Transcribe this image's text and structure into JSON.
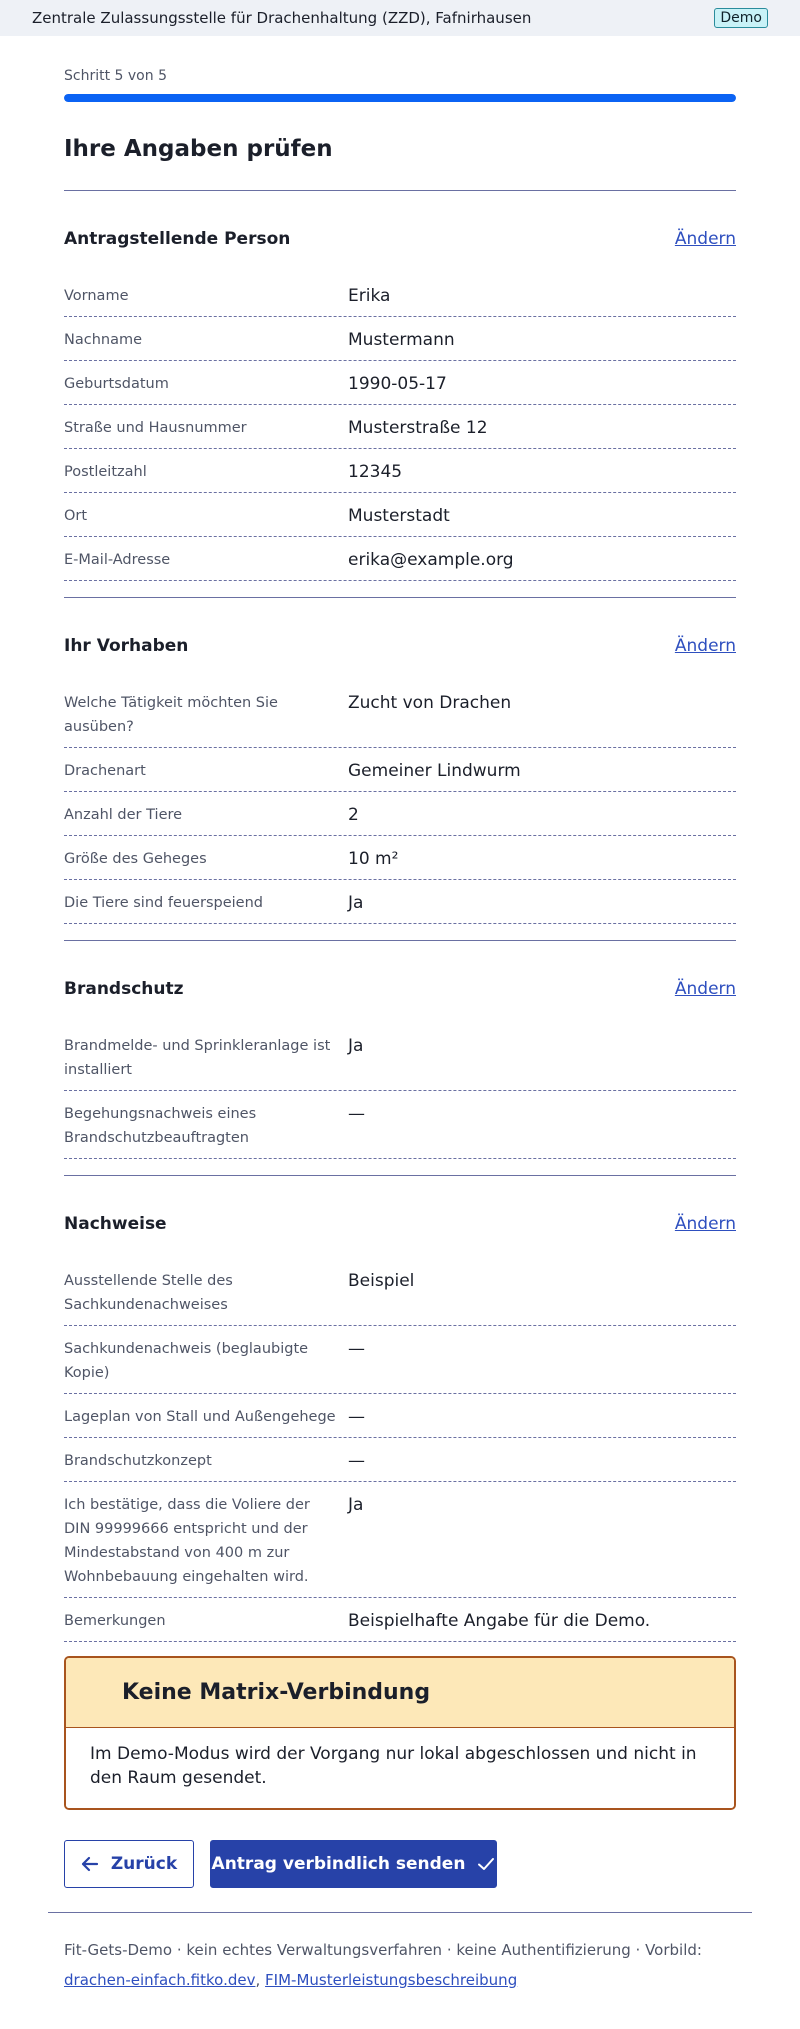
{
  "header": {
    "org": "Zentrale Zulassungsstelle für Drachenhaltung (ZZD), Fafnirhausen",
    "badge": "Demo"
  },
  "progress": {
    "step_label": "Schritt 5 von 5",
    "fraction": 1.0
  },
  "page_title": "Ihre Angaben prüfen",
  "sections": [
    {
      "title": "Antragstellende Person",
      "edit_label": "Ändern",
      "rows": [
        {
          "label": "Vorname",
          "value": "Erika"
        },
        {
          "label": "Nachname",
          "value": "Mustermann"
        },
        {
          "label": "Geburtsdatum",
          "value": "1990-05-17"
        },
        {
          "label": "Straße und Hausnummer",
          "value": "Musterstraße 12"
        },
        {
          "label": "Postleitzahl",
          "value": "12345"
        },
        {
          "label": "Ort",
          "value": "Musterstadt"
        },
        {
          "label": "E-Mail-Adresse",
          "value": "erika@example.org"
        }
      ]
    },
    {
      "title": "Ihr Vorhaben",
      "edit_label": "Ändern",
      "rows": [
        {
          "label": "Welche Tätigkeit möchten Sie ausüben?",
          "value": "Zucht von Drachen"
        },
        {
          "label": "Drachenart",
          "value": "Gemeiner Lindwurm"
        },
        {
          "label": "Anzahl der Tiere",
          "value": "2"
        },
        {
          "label": "Größe des Geheges",
          "value": "10 m²"
        },
        {
          "label": "Die Tiere sind feuerspeiend",
          "value": "Ja"
        }
      ]
    },
    {
      "title": "Brandschutz",
      "edit_label": "Ändern",
      "rows": [
        {
          "label": "Brandmelde- und Sprinkleranlage ist installiert",
          "value": "Ja"
        },
        {
          "label": "Begehungsnachweis eines Brandschutzbeauftragten",
          "value": "—"
        }
      ]
    },
    {
      "title": "Nachweise",
      "edit_label": "Ändern",
      "rows": [
        {
          "label": "Ausstellende Stelle des Sachkundenachweises",
          "value": "Beispiel"
        },
        {
          "label": "Sachkundenachweis (beglaubigte Kopie)",
          "value": "—"
        },
        {
          "label": "Lageplan von Stall und Außengehege",
          "value": "—"
        },
        {
          "label": "Brandschutzkonzept",
          "value": "—"
        },
        {
          "label": "Ich bestätige, dass die Voliere der DIN 99999666 entspricht und der Mindestabstand von 400 m zur Wohnbebauung eingehalten wird.",
          "value": "Ja"
        },
        {
          "label": "Bemerkungen",
          "value": "Beispielhafte Angabe für die Demo."
        }
      ]
    }
  ],
  "alert": {
    "title": "Keine Matrix-Verbindung",
    "body": "Im Demo-Modus wird der Vorgang nur lokal abgeschlossen und nicht in den Raum gesendet."
  },
  "actions": {
    "back_label": "Zurück",
    "back_icon": "arrow-left-icon",
    "send_label": "Antrag verbindlich senden",
    "send_icon": "check-icon"
  },
  "footer": {
    "text": "Fit-Gets-Demo · kein echtes Verwaltungsverfahren · keine Authentifizierung · Vorbild:",
    "link1": "drachen-einfach.fitko.dev",
    "separator": ",",
    "link2": "FIM-Musterleistungsbeschreibung"
  },
  "colors": {
    "primary": "#2742a8",
    "progress": "#0b63f4",
    "alert_bg": "#fde8b8",
    "alert_border": "#a8541e",
    "link": "#2e4fbf"
  }
}
